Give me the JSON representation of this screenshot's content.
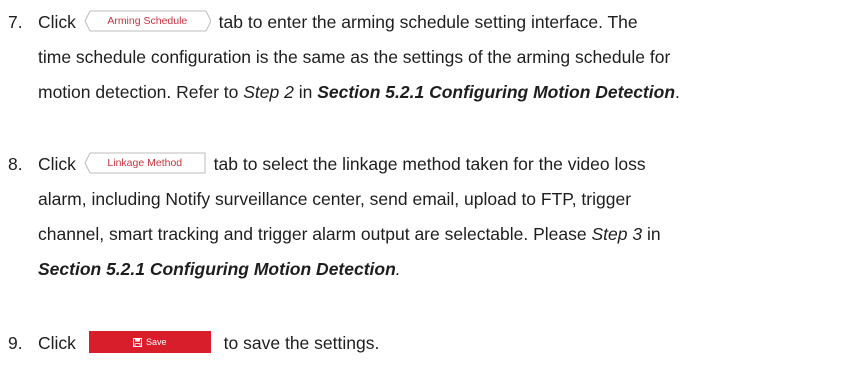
{
  "step7": {
    "number": "7.",
    "click": "Click",
    "tab_label": "Arming Schedule",
    "text_after_tab": "tab to enter the arming schedule setting interface. The",
    "line2": "time schedule configuration is the same as the settings of the arming schedule for",
    "line3_pre": "motion detection. Refer to ",
    "line3_step": "Step 2",
    "line3_mid": " in ",
    "line3_section": "Section 5.2.1 Configuring Motion Detection",
    "line3_end": "."
  },
  "step8": {
    "number": "8.",
    "click": "Click",
    "tab_label": "Linkage Method",
    "text_after_tab": "tab to select the linkage method taken for the video loss",
    "line2": "alarm, including Notify surveillance center, send email, upload to FTP, trigger",
    "line3_pre": "channel, smart tracking and trigger alarm output are selectable. Please ",
    "line3_step": "Step 3",
    "line3_end": " in",
    "line4_section": "Section 5.2.1 Configuring Motion Detection",
    "line4_end": "."
  },
  "step9": {
    "number": "9.",
    "click": "Click",
    "button_label": "Save",
    "text_after_button": "to save the settings."
  },
  "colors": {
    "tab_text": "#c8343a",
    "save_button": "#d81e2a"
  }
}
